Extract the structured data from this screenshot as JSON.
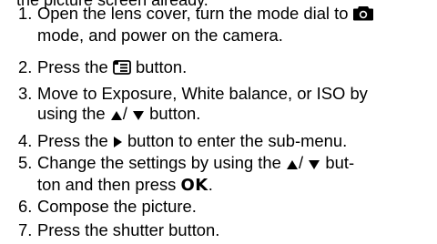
{
  "header_fragment": "the picture screen already.",
  "steps": {
    "s1": {
      "num": "1.",
      "a": "Open the lens cover, turn the mode dial to",
      "b": "mode, and power on the camera."
    },
    "s2": {
      "num": "2.",
      "a": "Press the",
      "b": "button."
    },
    "s3": {
      "num": "3.",
      "a": "Move to Exposure, White balance, or ISO by",
      "b": "using the",
      "c": "/",
      "d": "button."
    },
    "s4": {
      "num": "4.",
      "a": "Press the",
      "b": "button to enter the sub-menu."
    },
    "s5": {
      "num": "5.",
      "a": "Change the settings by using the",
      "b": "/",
      "c": "but-",
      "d": "ton and then press",
      "ok": "OK",
      "e": "."
    },
    "s6": {
      "num": "6.",
      "a": "Compose the picture."
    },
    "s7": {
      "num": "7.",
      "a": "Press the shutter button."
    }
  },
  "icons": {
    "camera": "camera-mode-icon",
    "menu": "menu-button-icon",
    "up": "up-arrow-icon",
    "down": "down-arrow-icon",
    "right": "right-arrow-icon"
  }
}
